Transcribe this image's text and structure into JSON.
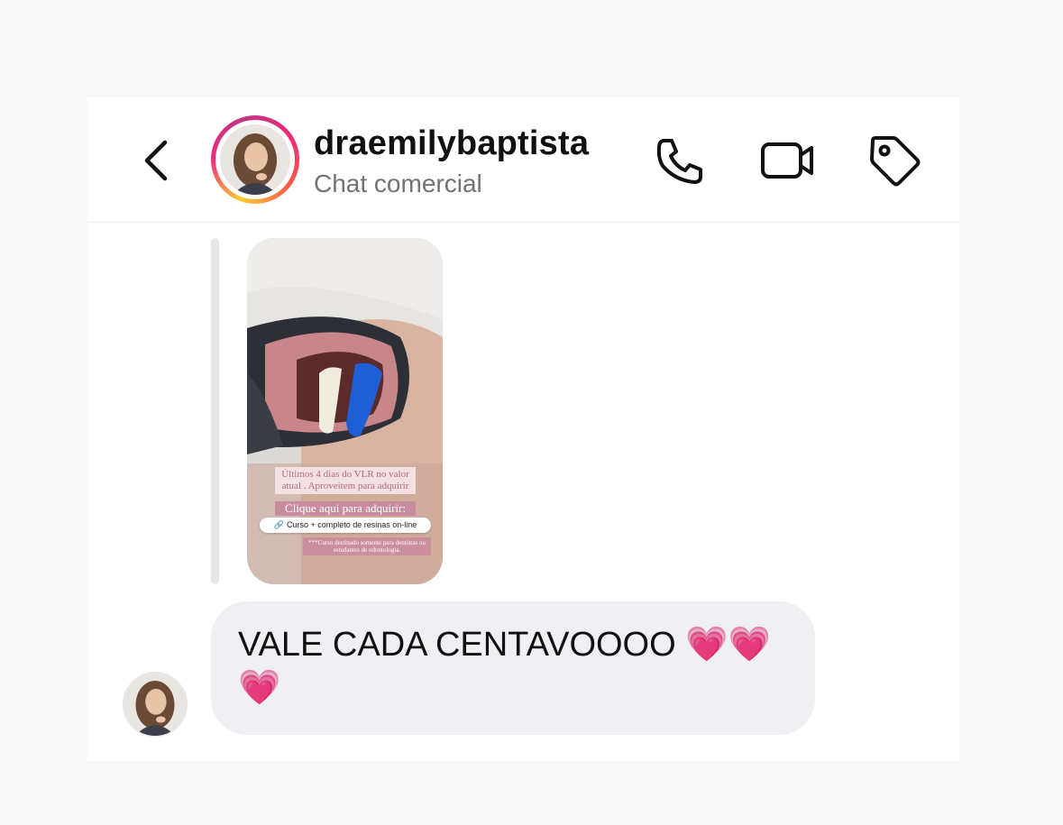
{
  "header": {
    "username": "draemilybaptista",
    "subtitle": "Chat comercial",
    "icons": [
      "back-chevron-icon",
      "phone-icon",
      "video-camera-icon",
      "tag-icon"
    ]
  },
  "story": {
    "caption": "Últimos 4 dias do VLR no valor atual . Aproveitem para adquirir",
    "cta": "Clique aqui para adquirir:",
    "link": "Curso + completo de resinas on-line",
    "note": "***Curso destinado somente para dentistas ou estudantes de odontologia."
  },
  "message": {
    "text": "VALE CADA CENTAVOOOO",
    "emoji": "💗💗💗"
  },
  "colors": {
    "bubble": "#efeff4",
    "heart": "#ff3fa4",
    "ring_start": "#f9ce34",
    "ring_end": "#c13584"
  }
}
